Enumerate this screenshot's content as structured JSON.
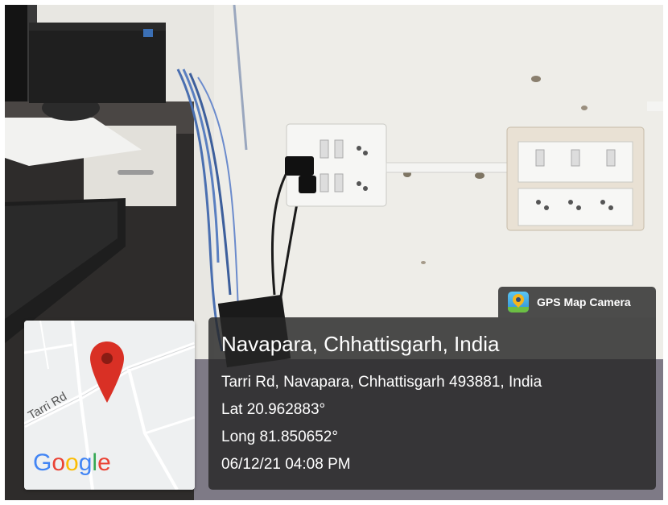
{
  "map": {
    "road_label": "Tarri Rd",
    "google_logo": [
      "G",
      "o",
      "o",
      "g",
      "l",
      "e"
    ],
    "google_colors": [
      "#4285F4",
      "#EA4335",
      "#FBBC05",
      "#4285F4",
      "#34A853",
      "#EA4335"
    ],
    "pin_icon": "map-pin-icon",
    "pin_color": "#d93025"
  },
  "badge": {
    "icon": "gps-map-camera-app-icon",
    "label": "GPS Map Camera"
  },
  "info": {
    "place": "Navapara, Chhattisgarh, India",
    "address": "Tarri Rd, Navapara, Chhattisgarh 493881, India",
    "lat": "Lat 20.962883°",
    "long": "Long 81.850652°",
    "datetime": "06/12/21 04:08 PM"
  }
}
